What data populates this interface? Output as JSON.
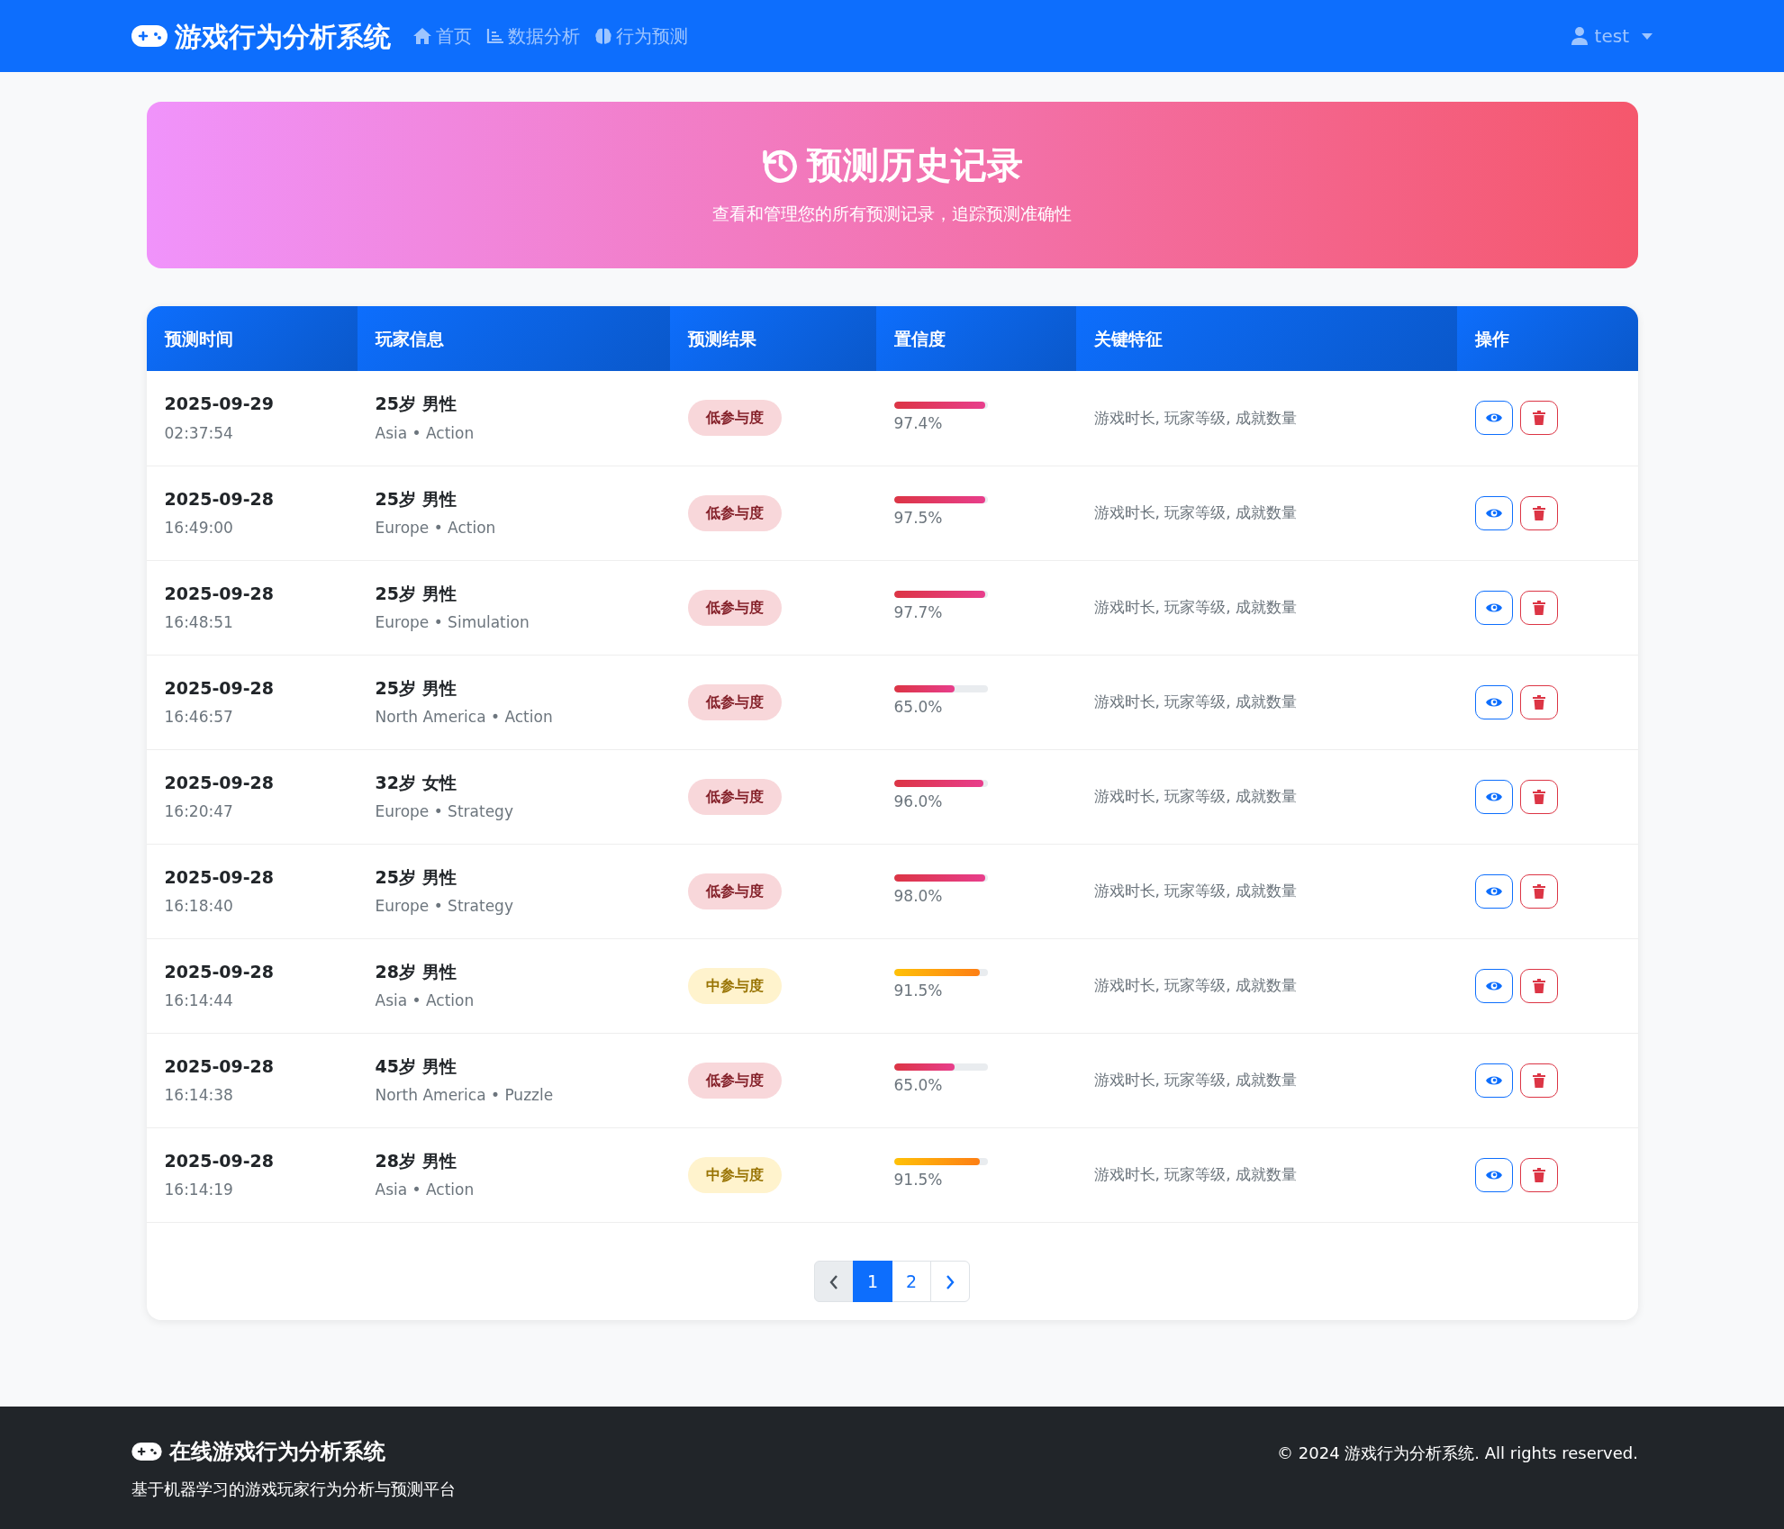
{
  "navbar": {
    "brand": "游戏行为分析系统",
    "links": [
      {
        "label": "首页",
        "kind": "home"
      },
      {
        "label": "数据分析",
        "kind": "chart"
      },
      {
        "label": "行为预测",
        "kind": "brain"
      }
    ],
    "user": "test"
  },
  "header": {
    "title": "预测历史记录",
    "subtitle": "查看和管理您的所有预测记录，追踪预测准确性"
  },
  "table": {
    "columns": [
      "预测时间",
      "玩家信息",
      "预测结果",
      "置信度",
      "关键特征",
      "操作"
    ],
    "rows": [
      {
        "date": "2025-09-29",
        "time": "02:37:54",
        "player": "25岁 男性",
        "details": "Asia • Action",
        "result": {
          "label": "低参与度",
          "kind": "low"
        },
        "confidence": {
          "level": 0.974,
          "reading": "97.4%"
        },
        "features": "游戏时长, 玩家等级, 成就数量"
      },
      {
        "date": "2025-09-28",
        "time": "16:49:00",
        "player": "25岁 男性",
        "details": "Europe • Action",
        "result": {
          "label": "低参与度",
          "kind": "low"
        },
        "confidence": {
          "level": 0.975,
          "reading": "97.5%"
        },
        "features": "游戏时长, 玩家等级, 成就数量"
      },
      {
        "date": "2025-09-28",
        "time": "16:48:51",
        "player": "25岁 男性",
        "details": "Europe • Simulation",
        "result": {
          "label": "低参与度",
          "kind": "low"
        },
        "confidence": {
          "level": 0.977,
          "reading": "97.7%"
        },
        "features": "游戏时长, 玩家等级, 成就数量"
      },
      {
        "date": "2025-09-28",
        "time": "16:46:57",
        "player": "25岁 男性",
        "details": "North America • Action",
        "result": {
          "label": "低参与度",
          "kind": "low"
        },
        "confidence": {
          "level": 0.65,
          "reading": "65.0%"
        },
        "features": "游戏时长, 玩家等级, 成就数量"
      },
      {
        "date": "2025-09-28",
        "time": "16:20:47",
        "player": "32岁 女性",
        "details": "Europe • Strategy",
        "result": {
          "label": "低参与度",
          "kind": "low"
        },
        "confidence": {
          "level": 0.96,
          "reading": "96.0%"
        },
        "features": "游戏时长, 玩家等级, 成就数量"
      },
      {
        "date": "2025-09-28",
        "time": "16:18:40",
        "player": "25岁 男性",
        "details": "Europe • Strategy",
        "result": {
          "label": "低参与度",
          "kind": "low"
        },
        "confidence": {
          "level": 0.98,
          "reading": "98.0%"
        },
        "features": "游戏时长, 玩家等级, 成就数量"
      },
      {
        "date": "2025-09-28",
        "time": "16:14:44",
        "player": "28岁 男性",
        "details": "Asia • Action",
        "result": {
          "label": "中参与度",
          "kind": "mid"
        },
        "confidence": {
          "level": 0.915,
          "reading": "91.5%"
        },
        "features": "游戏时长, 玩家等级, 成就数量"
      },
      {
        "date": "2025-09-28",
        "time": "16:14:38",
        "player": "45岁 男性",
        "details": "North America • Puzzle",
        "result": {
          "label": "低参与度",
          "kind": "low"
        },
        "confidence": {
          "level": 0.65,
          "reading": "65.0%"
        },
        "features": "游戏时长, 玩家等级, 成就数量"
      },
      {
        "date": "2025-09-28",
        "time": "16:14:19",
        "player": "28岁 男性",
        "details": "Asia • Action",
        "result": {
          "label": "中参与度",
          "kind": "mid"
        },
        "confidence": {
          "level": 0.915,
          "reading": "91.5%"
        },
        "features": "游戏时长, 玩家等级, 成就数量"
      }
    ]
  },
  "pagination": {
    "prev_disabled": true,
    "pages": [
      {
        "label": "1",
        "selected": true
      },
      {
        "label": "2",
        "selected": false
      }
    ]
  },
  "footer": {
    "title": "在线游戏行为分析系统",
    "tagline": "基于机器学习的游戏玩家行为分析与预测平台",
    "copyright": "© 2024 游戏行为分析系统. All rights reserved."
  }
}
